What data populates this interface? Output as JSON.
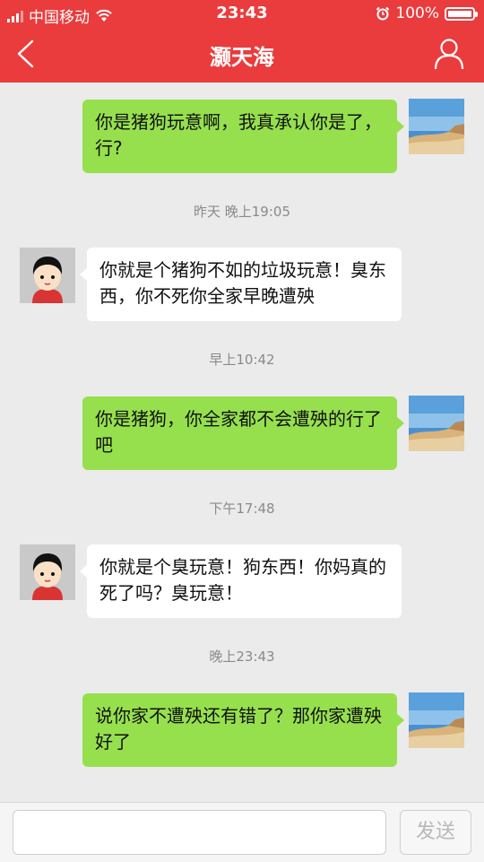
{
  "status_bar": {
    "carrier": "中国移动",
    "time": "23:43",
    "battery": "100%"
  },
  "header": {
    "title": "灏天海",
    "back_icon": "chevron-left-icon",
    "profile_icon": "user-icon"
  },
  "messages": [
    {
      "direction": "out",
      "text": "你是猪狗玩意啊，我真承认你是了，行?"
    },
    {
      "timestamp": "昨天 晚上19:05"
    },
    {
      "direction": "in",
      "text": "你就是个猪狗不如的垃圾玩意！臭东西，你不死你全家早晚遭殃"
    },
    {
      "timestamp": "早上10:42"
    },
    {
      "direction": "out",
      "text": "你是猪狗，你全家都不会遭殃的行了吧"
    },
    {
      "timestamp": "下午17:48"
    },
    {
      "direction": "in",
      "text": "你就是个臭玩意！狗东西！你妈真的死了吗？臭玩意！"
    },
    {
      "timestamp": "晚上23:43"
    },
    {
      "direction": "out",
      "text": "说你家不遭殃还有错了？那你家遭殃好了"
    }
  ],
  "composer": {
    "input_value": "",
    "send_label": "发送"
  },
  "colors": {
    "header": "#ea3c3d",
    "outgoing_bubble": "#96e04e",
    "incoming_bubble": "#ffffff",
    "background": "#ebebeb"
  }
}
